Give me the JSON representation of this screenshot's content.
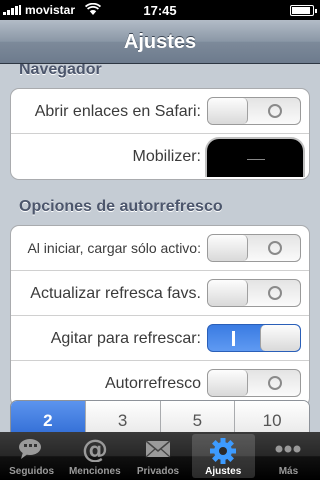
{
  "status_bar": {
    "carrier": "movistar",
    "time": "17:45",
    "battery_level": 0.9
  },
  "nav": {
    "title": "Ajustes"
  },
  "sections": {
    "browser": {
      "header": "Navegador",
      "rows": [
        {
          "label": "Abrir enlaces en Safari:",
          "control": "switch",
          "value": "off"
        },
        {
          "label": "Mobilizer:",
          "control": "device-picture"
        }
      ]
    },
    "refresh": {
      "header": "Opciones de autorrefresco",
      "rows": [
        {
          "label": "Al iniciar, cargar sólo activo:",
          "control": "switch",
          "value": "off"
        },
        {
          "label": "Actualizar refresca favs.",
          "control": "switch",
          "value": "off"
        },
        {
          "label": "Agitar para refrescar:",
          "control": "switch",
          "value": "on"
        },
        {
          "label": "Autorrefresco",
          "control": "switch",
          "value": "off"
        }
      ]
    }
  },
  "interval_selector": {
    "options": [
      "2",
      "3",
      "5",
      "10"
    ],
    "selected": "2"
  },
  "tab_bar": {
    "tabs": [
      {
        "label": "Seguidos",
        "icon": "speech-bubbles-icon"
      },
      {
        "label": "Menciones",
        "icon": "at-sign-icon"
      },
      {
        "label": "Privados",
        "icon": "envelope-icon"
      },
      {
        "label": "Ajustes",
        "icon": "gear-icon"
      },
      {
        "label": "Más",
        "icon": "more-dots-icon"
      }
    ],
    "active": "Ajustes"
  },
  "colors": {
    "accent": "#3a7be2",
    "section_header": "#4c566c",
    "background": "#c5ccd4"
  }
}
